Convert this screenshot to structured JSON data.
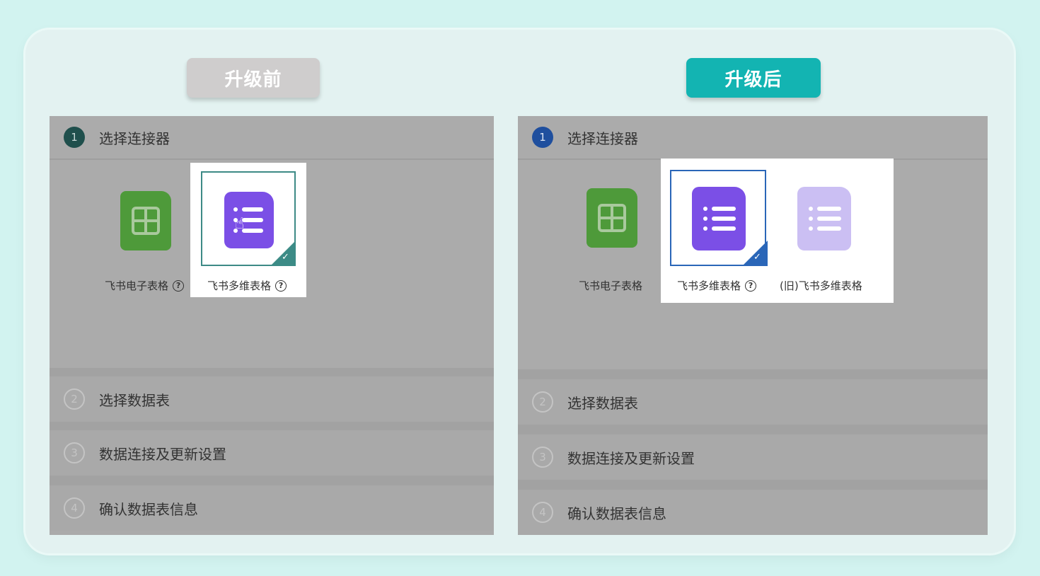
{
  "before": {
    "badge": "升级前",
    "steps": [
      {
        "num": "1",
        "title": "选择连接器"
      },
      {
        "num": "2",
        "title": "选择数据表"
      },
      {
        "num": "3",
        "title": "数据连接及更新设置"
      },
      {
        "num": "4",
        "title": "确认数据表信息"
      }
    ],
    "connectors": [
      {
        "label": "飞书电子表格",
        "help": "?",
        "icon": "sheet-icon"
      },
      {
        "label": "飞书多维表格",
        "help": "?",
        "icon": "base-icon",
        "selected": true
      }
    ]
  },
  "after": {
    "badge": "升级后",
    "steps": [
      {
        "num": "1",
        "title": "选择连接器"
      },
      {
        "num": "2",
        "title": "选择数据表"
      },
      {
        "num": "3",
        "title": "数据连接及更新设置"
      },
      {
        "num": "4",
        "title": "确认数据表信息"
      }
    ],
    "connectors": [
      {
        "label": "飞书电子表格",
        "icon": "sheet-icon"
      },
      {
        "label": "飞书多维表格",
        "help": "?",
        "icon": "base-icon",
        "selected": true
      },
      {
        "label": "(旧)飞书多维表格",
        "icon": "base-icon-legacy"
      }
    ]
  },
  "colors": {
    "background": "#d2f3f0",
    "badge_before": "#cfcdcd",
    "badge_after": "#13b4b2",
    "base_purple": "#7b4fe6",
    "sheet_green": "#4e9a3a"
  }
}
